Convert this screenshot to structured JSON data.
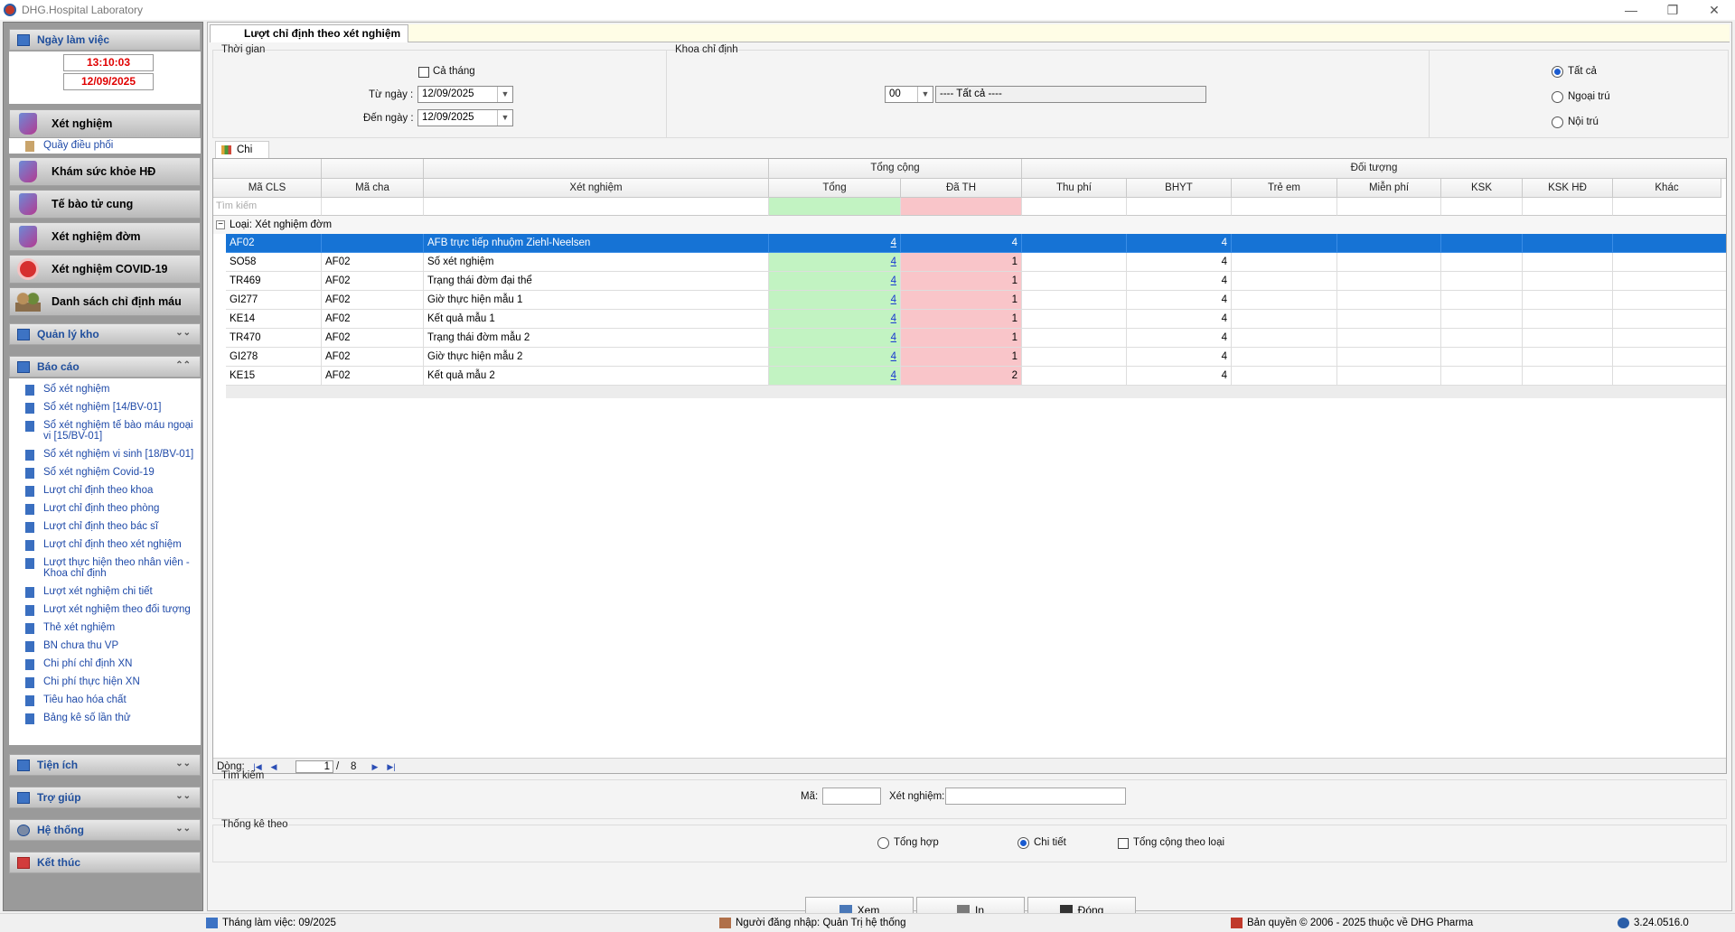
{
  "window": {
    "title": "DHG.Hospital Laboratory",
    "minimize": "—",
    "restore": "❐",
    "close": "✕"
  },
  "sidebar": {
    "workday": {
      "label": "Ngày làm việc",
      "time": "13:10:03",
      "date": "12/09/2025"
    },
    "modules": [
      {
        "label": "Xét nghiệm",
        "sub": "Quầy điều phối"
      },
      {
        "label": "Khám sức khỏe HĐ"
      },
      {
        "label": "Tế bào tử cung"
      },
      {
        "label": "Xét nghiệm đờm"
      },
      {
        "label": "Xét nghiệm COVID-19"
      },
      {
        "label": "Danh sách chỉ định máu"
      }
    ],
    "warehouse": "Quản lý kho",
    "reports": {
      "label": "Báo cáo",
      "items": [
        "Sổ xét nghiệm",
        "Sổ xét nghiệm [14/BV-01]",
        "Sổ xét nghiệm tế bào máu ngoại vi [15/BV-01]",
        "Sổ xét nghiệm vi sinh [18/BV-01]",
        "Sổ xét nghiệm Covid-19",
        "Lượt chỉ định theo khoa",
        "Lượt chỉ định theo phòng",
        "Lượt chỉ định theo bác sĩ",
        "Lượt chỉ định theo xét nghiệm",
        "Lượt thực hiện theo nhân viên - Khoa chỉ định",
        "Lượt xét nghiệm chi tiết",
        "Lượt xét nghiệm theo đối tượng",
        "Thẻ xét nghiệm",
        "BN chưa thu VP",
        "Chi phí chỉ định XN",
        "Chi phí thực hiện XN",
        "Tiêu hao hóa chất",
        "Bảng kê số lần thử"
      ]
    },
    "utilities": "Tiện ích",
    "help": "Trợ giúp",
    "system": "Hệ thống",
    "exit": "Kết thúc"
  },
  "tab": {
    "title": "Lượt chỉ định theo xét nghiệm"
  },
  "filters": {
    "time_group": "Thời gian",
    "whole_month": "Cả tháng",
    "from_label": "Từ ngày :",
    "from_date": "12/09/2025",
    "to_label": "Đến ngày :",
    "to_date": "12/09/2025",
    "dept_group": "Khoa chỉ định",
    "dept_code": "00",
    "dept_name": "---- Tất cả ----",
    "scope_options": [
      "Tất cả",
      "Ngoại trú",
      "Nội trú"
    ],
    "scope_selected": "Tất cả"
  },
  "detail_tab": "Chi tiết",
  "grid": {
    "band_total": "Tổng cộng",
    "band_object": "Đối tượng",
    "columns": [
      "Mã CLS",
      "Mã cha",
      "Xét nghiệm",
      "Tổng",
      "Đã TH",
      "Thu phí",
      "BHYT",
      "Trẻ em",
      "Miễn phí",
      "KSK",
      "KSK HĐ",
      "Khác"
    ],
    "filter_placeholder": "Tìm kiếm",
    "group_label": "Loại:  Xét nghiệm đờm",
    "rows": [
      {
        "code": "AF02",
        "parent": "",
        "name": "AFB trực tiếp nhuộm Ziehl-Neelsen",
        "total": "4",
        "done": "4",
        "bhyt": "4"
      },
      {
        "code": "SO58",
        "parent": "AF02",
        "name": "Số xét nghiệm",
        "total": "4",
        "done": "1",
        "bhyt": "4"
      },
      {
        "code": "TR469",
        "parent": "AF02",
        "name": "Trạng thái đờm đại thể",
        "total": "4",
        "done": "1",
        "bhyt": "4"
      },
      {
        "code": "GI277",
        "parent": "AF02",
        "name": "Giờ thực hiện mẫu 1",
        "total": "4",
        "done": "1",
        "bhyt": "4"
      },
      {
        "code": "KE14",
        "parent": "AF02",
        "name": "Kết quả mẫu 1",
        "total": "4",
        "done": "1",
        "bhyt": "4"
      },
      {
        "code": "TR470",
        "parent": "AF02",
        "name": "Trạng thái đờm mẫu 2",
        "total": "4",
        "done": "1",
        "bhyt": "4"
      },
      {
        "code": "GI278",
        "parent": "AF02",
        "name": "Giờ thực hiện mẫu 2",
        "total": "4",
        "done": "1",
        "bhyt": "4"
      },
      {
        "code": "KE15",
        "parent": "AF02",
        "name": "Kết quả mẫu 2",
        "total": "4",
        "done": "2",
        "bhyt": "4"
      }
    ],
    "pager": {
      "label": "Dòng:",
      "current": "1",
      "separator": "/",
      "total": "8"
    }
  },
  "search": {
    "group": "Tìm kiếm",
    "code_label": "Mã:",
    "name_label": "Xét nghiệm:"
  },
  "stats": {
    "group": "Thống kê theo",
    "summary": "Tổng hợp",
    "detail": "Chi tiết",
    "by_type": "Tổng cộng theo loại",
    "selected": "Chi tiết"
  },
  "buttons": {
    "view": "Xem",
    "print": "In",
    "close": "Đóng"
  },
  "statusbar": {
    "month": "Tháng làm việc: 09/2025",
    "user": "Người đăng nhập: Quản Trị hệ thống",
    "copyright": "Bản quyền © 2006 - 2025 thuộc về DHG Pharma",
    "version": "3.24.0516.0"
  },
  "colors": {
    "selected_row": "#1673d5",
    "total_cell": "#c2f3c2",
    "done_cell": "#f9c5c9",
    "clock_text": "#e00000",
    "link": "#1f4aa8"
  }
}
